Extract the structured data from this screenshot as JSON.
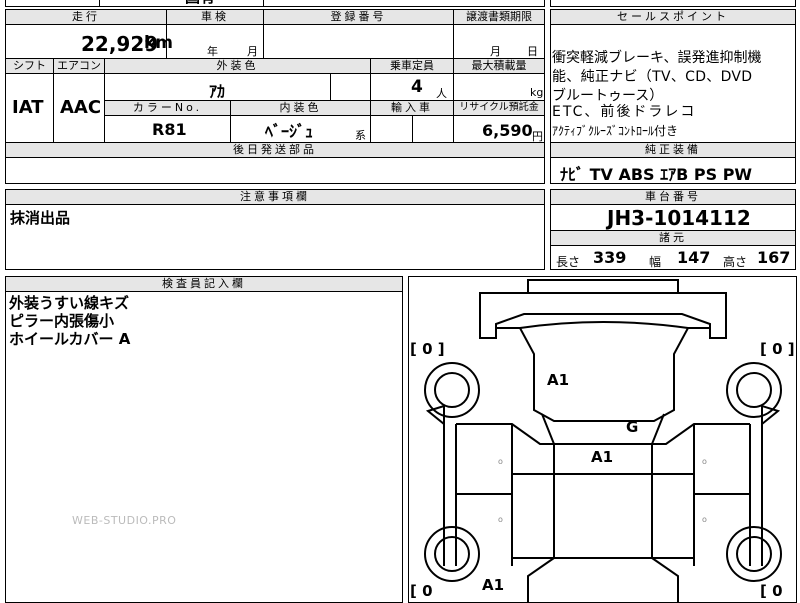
{
  "top_partial": {
    "text": "国有"
  },
  "mileage": {
    "header": "走行",
    "value": "22,929",
    "unit": "km"
  },
  "inspection": {
    "header": "車検",
    "year_label": "年",
    "month_label": "月"
  },
  "registration": {
    "header": "登録番号"
  },
  "transfer": {
    "header": "譲渡書類期限",
    "month_label": "月",
    "day_label": "日"
  },
  "shift": {
    "header": "シフト",
    "value": "IAT"
  },
  "aircon": {
    "header": "エアコン",
    "value": "AAC"
  },
  "exterior_color": {
    "header": "外装色",
    "value": "ｱｶ"
  },
  "capacity": {
    "header": "乗車定員",
    "value": "4",
    "unit": "人"
  },
  "max_load": {
    "header": "最大積載量",
    "unit": "kg"
  },
  "color_no": {
    "header": "カラーNo.",
    "value": "R81"
  },
  "interior_color": {
    "header": "内装色",
    "value": "ﾍﾞｰｼﾞｭ",
    "suffix": "系"
  },
  "import": {
    "header": "輸入車"
  },
  "recycle": {
    "header": "リサイクル預託金",
    "value": "6,590",
    "unit": "円"
  },
  "later_parts": {
    "header": "後日発送部品"
  },
  "sales_points": {
    "header": "セールスポイント",
    "lines": [
      "衝突軽減ブレーキ、誤発進抑制機",
      "能、純正ナビ（TV、CD、DVD",
      "ブルートゥース）",
      "ETC、前後ドラレコ",
      "ｱｸﾃｨﾌﾞｸﾙｰｽﾞｺﾝﾄﾛｰﾙ付き"
    ]
  },
  "equipment": {
    "header": "純正装備",
    "value": "ﾅﾋﾞ TV ABS ｴｱB PS PW"
  },
  "notes": {
    "header": "注意事項欄",
    "value": "抹消出品"
  },
  "chassis": {
    "header": "車台番号",
    "value": "JH3-1014112"
  },
  "specs": {
    "header": "諸元",
    "length_label": "長さ",
    "length": "339",
    "width_label": "幅",
    "width": "147",
    "height_label": "高さ",
    "height": "167"
  },
  "inspector": {
    "header": "検査員記入欄",
    "lines": [
      "外装うすい線キズ",
      "ピラー内張傷小",
      "ホイールカバー A"
    ]
  },
  "diagram": {
    "marks": {
      "hood": "A1",
      "windshield": "G",
      "roof": "A1",
      "rear_left": "A1"
    },
    "tire_left_top": "[ 0 ]",
    "tire_right_top": "[ 0 ]",
    "tire_left_bottom": "[ 0",
    "tire_right_bottom": "[ 0"
  },
  "watermark": "WEB-STUDIO.PRO"
}
